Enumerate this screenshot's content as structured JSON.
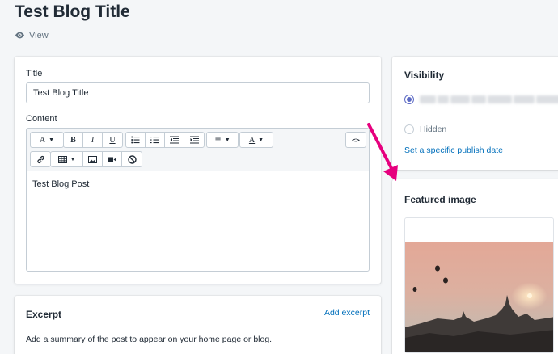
{
  "page": {
    "title": "Test Blog Title",
    "view_label": "View"
  },
  "post": {
    "title_label": "Title",
    "title_value": "Test Blog Title",
    "content_label": "Content",
    "content_text": "Test Blog Post"
  },
  "toolbar": {
    "font_button": "A",
    "bold": "B",
    "italic": "I",
    "underline": "U",
    "align_glyph": "≡",
    "color_glyph": "A",
    "html_glyph": "<>"
  },
  "excerpt": {
    "title": "Excerpt",
    "add_label": "Add excerpt",
    "description": "Add a summary of the post to appear on your home page or blog."
  },
  "visibility": {
    "title": "Visibility",
    "hidden_label": "Hidden",
    "publish_link": "Set a specific publish date"
  },
  "featured": {
    "title": "Featured image"
  },
  "colors": {
    "accent": "#5c6ac4",
    "link": "#006fbb",
    "annotation_arrow": "#e6007e"
  }
}
